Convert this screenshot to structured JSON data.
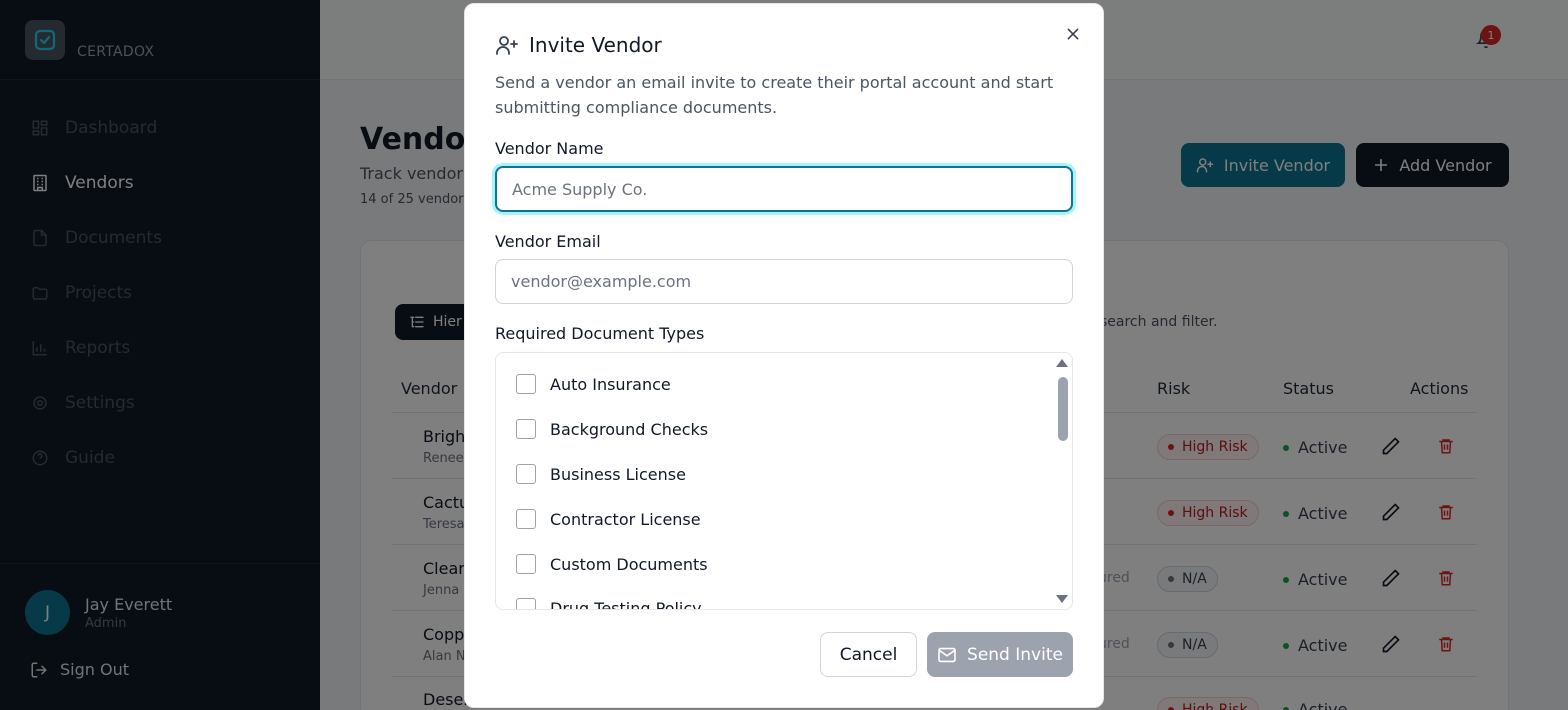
{
  "app": {
    "name": "CERTADOX"
  },
  "sidebar": {
    "items": [
      {
        "label": "Dashboard",
        "icon": "dashboard-icon"
      },
      {
        "label": "Vendors",
        "icon": "building-icon",
        "active": true
      },
      {
        "label": "Documents",
        "icon": "documents-icon"
      },
      {
        "label": "Projects",
        "icon": "folder-icon"
      },
      {
        "label": "Reports",
        "icon": "chart-icon"
      },
      {
        "label": "Settings",
        "icon": "gear-icon"
      },
      {
        "label": "Guide",
        "icon": "help-icon"
      }
    ],
    "user": {
      "initial": "J",
      "name": "Jay Everett",
      "role": "Admin"
    },
    "signout_label": "Sign Out"
  },
  "topbar": {
    "notification_count": "1"
  },
  "page": {
    "title": "Vendor",
    "subtitle": "Track vendor",
    "count": "14 of 25 vendor",
    "invite_button": "Invite Vendor",
    "add_button": "Add Vendor",
    "hierarchy_button": "Hier",
    "search_hint": "search and filter.",
    "table": {
      "headers": {
        "vendor": "Vendor",
        "risk": "Risk",
        "status": "Status",
        "actions": "Actions"
      },
      "rows": [
        {
          "name": "Brigh",
          "contact": "Renee",
          "risk": "High Risk",
          "status": "Active"
        },
        {
          "name": "Cactu",
          "contact": "Teresa",
          "risk": "High Risk",
          "status": "Active"
        },
        {
          "name": "Clear",
          "contact": "Jenna",
          "insured": "ured",
          "risk": "N/A",
          "status": "Active"
        },
        {
          "name": "Copp",
          "contact": "Alan N",
          "insured": "ured",
          "risk": "N/A",
          "status": "Active"
        },
        {
          "name": "Deser",
          "contact": "",
          "risk": "High Risk",
          "status": "Active"
        }
      ]
    }
  },
  "modal": {
    "title": "Invite Vendor",
    "description": "Send a vendor an email invite to create their portal account and start submitting compliance documents.",
    "vendor_name_label": "Vendor Name",
    "vendor_name_placeholder": "Acme Supply Co.",
    "vendor_name_value": "",
    "vendor_email_label": "Vendor Email",
    "vendor_email_placeholder": "vendor@example.com",
    "vendor_email_value": "",
    "doc_types_label": "Required Document Types",
    "doc_types": [
      "Auto Insurance",
      "Background Checks",
      "Business License",
      "Contractor License",
      "Custom Documents",
      "Drug Testing Policy"
    ],
    "cancel_label": "Cancel",
    "send_label": "Send Invite"
  }
}
